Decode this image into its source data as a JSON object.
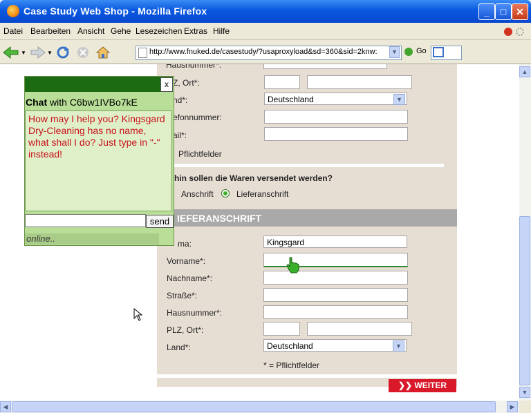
{
  "window": {
    "title": "Case Study Web Shop - Mozilla Firefox"
  },
  "menu": [
    "Datei",
    "Bearbeiten",
    "Ansicht",
    "Gehe",
    "Lesezeichen",
    "Extras",
    "Hilfe"
  ],
  "toolbar": {
    "url": "http://www.fnuked.de/casestudy/?usaproxyload&sd=360&sid=2knw:",
    "go_label": "Go"
  },
  "form_top": {
    "partial_header": "Hausnummer*:",
    "plz_label": "Z, Ort*:",
    "land_label": "nd*:",
    "land_value": "Deutschland",
    "telefon_label": "efonnummer:",
    "email_label": "ail*:",
    "pflicht_label": "Pflichtfelder",
    "shipping_question": "hin sollen die Waren versendet werden?",
    "option_anschrift": "Anschrift",
    "option_liefer": "Lieferanschrift"
  },
  "section_header": "IEFERANSCHRIFT",
  "delivery": {
    "firma_label": "ma:",
    "firma_value": "Kingsgard",
    "vorname_label": "Vorname*:",
    "nachname_label": "Nachname*:",
    "strasse_label": "Straße*:",
    "hausnummer_label": "Hausnummer*:",
    "plz_label": "PLZ, Ort*:",
    "land_label": "Land*:",
    "land_value": "Deutschland",
    "pflicht_note": "* = Pflichtfelder"
  },
  "weiter_label": "WEITER",
  "chat": {
    "close_label": "x",
    "title_prefix": "Chat",
    "title_middle": "with",
    "chat_id": "C6bw1IVBo7kE",
    "message": "How may I help you? Kingsgard Dry-Cleaning has no name, what shall I do? Just type in \"-\" instead!",
    "send_label": "send",
    "status": "online.."
  },
  "colors": {
    "accent": "#0a58e0",
    "chat_dark": "#1c6b12",
    "chat_text": "#c9101c",
    "weiter": "#d9182a"
  }
}
